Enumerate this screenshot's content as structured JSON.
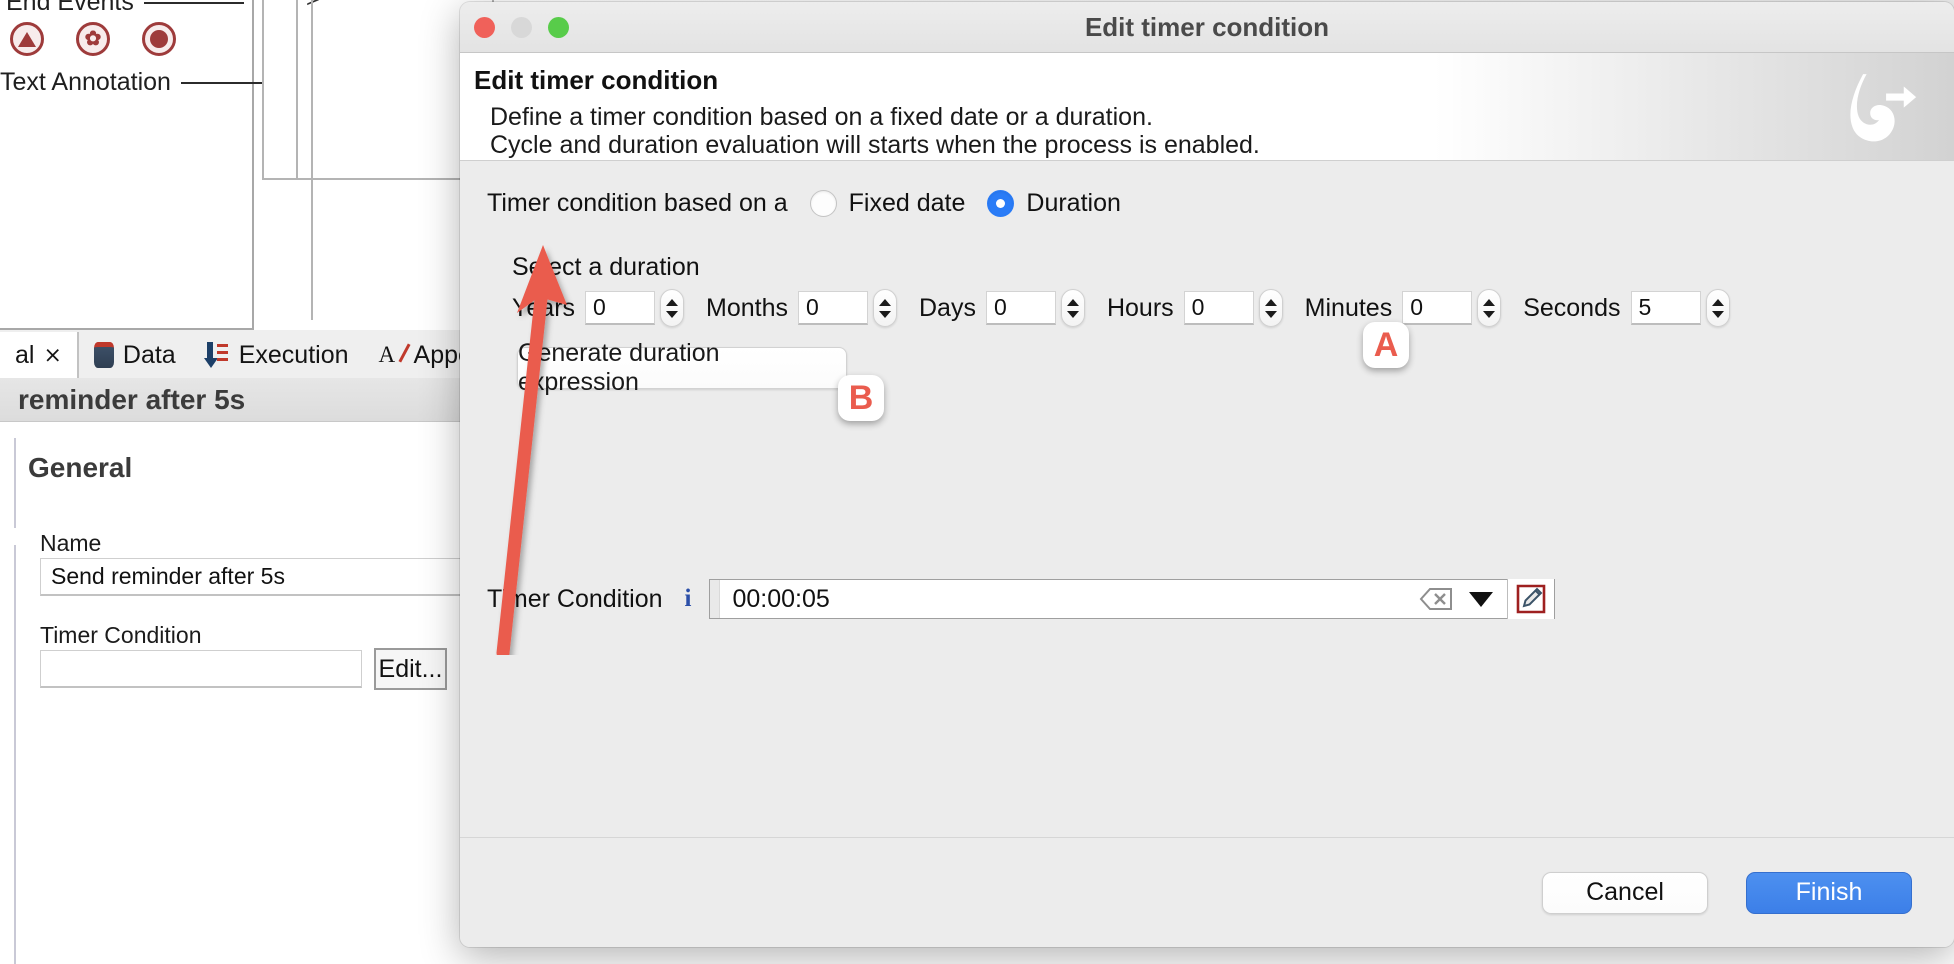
{
  "background": {
    "palette": {
      "end_events_label": "End Events",
      "text_annotation_label": "Text Annotation",
      "icons": [
        {
          "name": "terminate-end-event-icon",
          "glyph": "triangle"
        },
        {
          "name": "signal-end-event-icon",
          "glyph": "zigzag"
        },
        {
          "name": "error-end-event-icon",
          "glyph": "dot"
        }
      ],
      "canvas_caret": ">"
    },
    "tabs": [
      {
        "label": "al",
        "icon": "cross-icon",
        "active": true
      },
      {
        "label": "Data",
        "icon": "database-icon",
        "active": false
      },
      {
        "label": "Execution",
        "icon": "execution-arrow-icon",
        "active": false
      },
      {
        "label": "Appearance",
        "icon": "appearance-pen-icon",
        "active": false
      }
    ],
    "selection_title": "reminder after 5s",
    "section_title": "General",
    "fields": {
      "name_label": "Name",
      "name_value": "Send reminder after 5s",
      "timer_condition_label": "Timer Condition",
      "timer_condition_value": "",
      "timer_condition_placeholder": "",
      "edit_button_label": "Edit..."
    }
  },
  "dialog": {
    "window_title": "Edit timer condition",
    "traffic_lights": [
      "close-button",
      "minimize-button",
      "zoom-button"
    ],
    "heading": "Edit timer condition",
    "description_line1": "Define a timer condition based on a fixed date or a duration.",
    "description_line2": "Cycle and duration evaluation will starts when the process is enabled.",
    "logo_name": "bonita-logo",
    "based_on_label": "Timer condition based on a",
    "radios": [
      {
        "label": "Fixed date",
        "selected": false
      },
      {
        "label": "Duration",
        "selected": true
      }
    ],
    "select_duration_label": "Select a duration",
    "duration_fields": [
      {
        "label": "Years",
        "value": "0"
      },
      {
        "label": "Months",
        "value": "0"
      },
      {
        "label": "Days",
        "value": "0"
      },
      {
        "label": "Hours",
        "value": "0"
      },
      {
        "label": "Minutes",
        "value": "0"
      },
      {
        "label": "Seconds",
        "value": "5"
      }
    ],
    "generate_button_label": "Generate duration expression",
    "timer_condition": {
      "label": "Timer Condition",
      "info_icon": "info-icon",
      "value": "00:00:05",
      "clear_icon": "clear-icon",
      "dropdown_icon": "chevron-down-icon",
      "edit_icon": "pencil-edit-icon"
    },
    "footer": {
      "cancel_label": "Cancel",
      "finish_label": "Finish"
    },
    "colors": {
      "accent_blue": "#2a7cf7",
      "finish_button": "#3c7fe8",
      "annotation_red": "#ea5c4e",
      "pencil_border_red": "#9e2020"
    }
  },
  "annotations": [
    {
      "id": "A",
      "label": "A"
    },
    {
      "id": "B",
      "label": "B"
    }
  ]
}
